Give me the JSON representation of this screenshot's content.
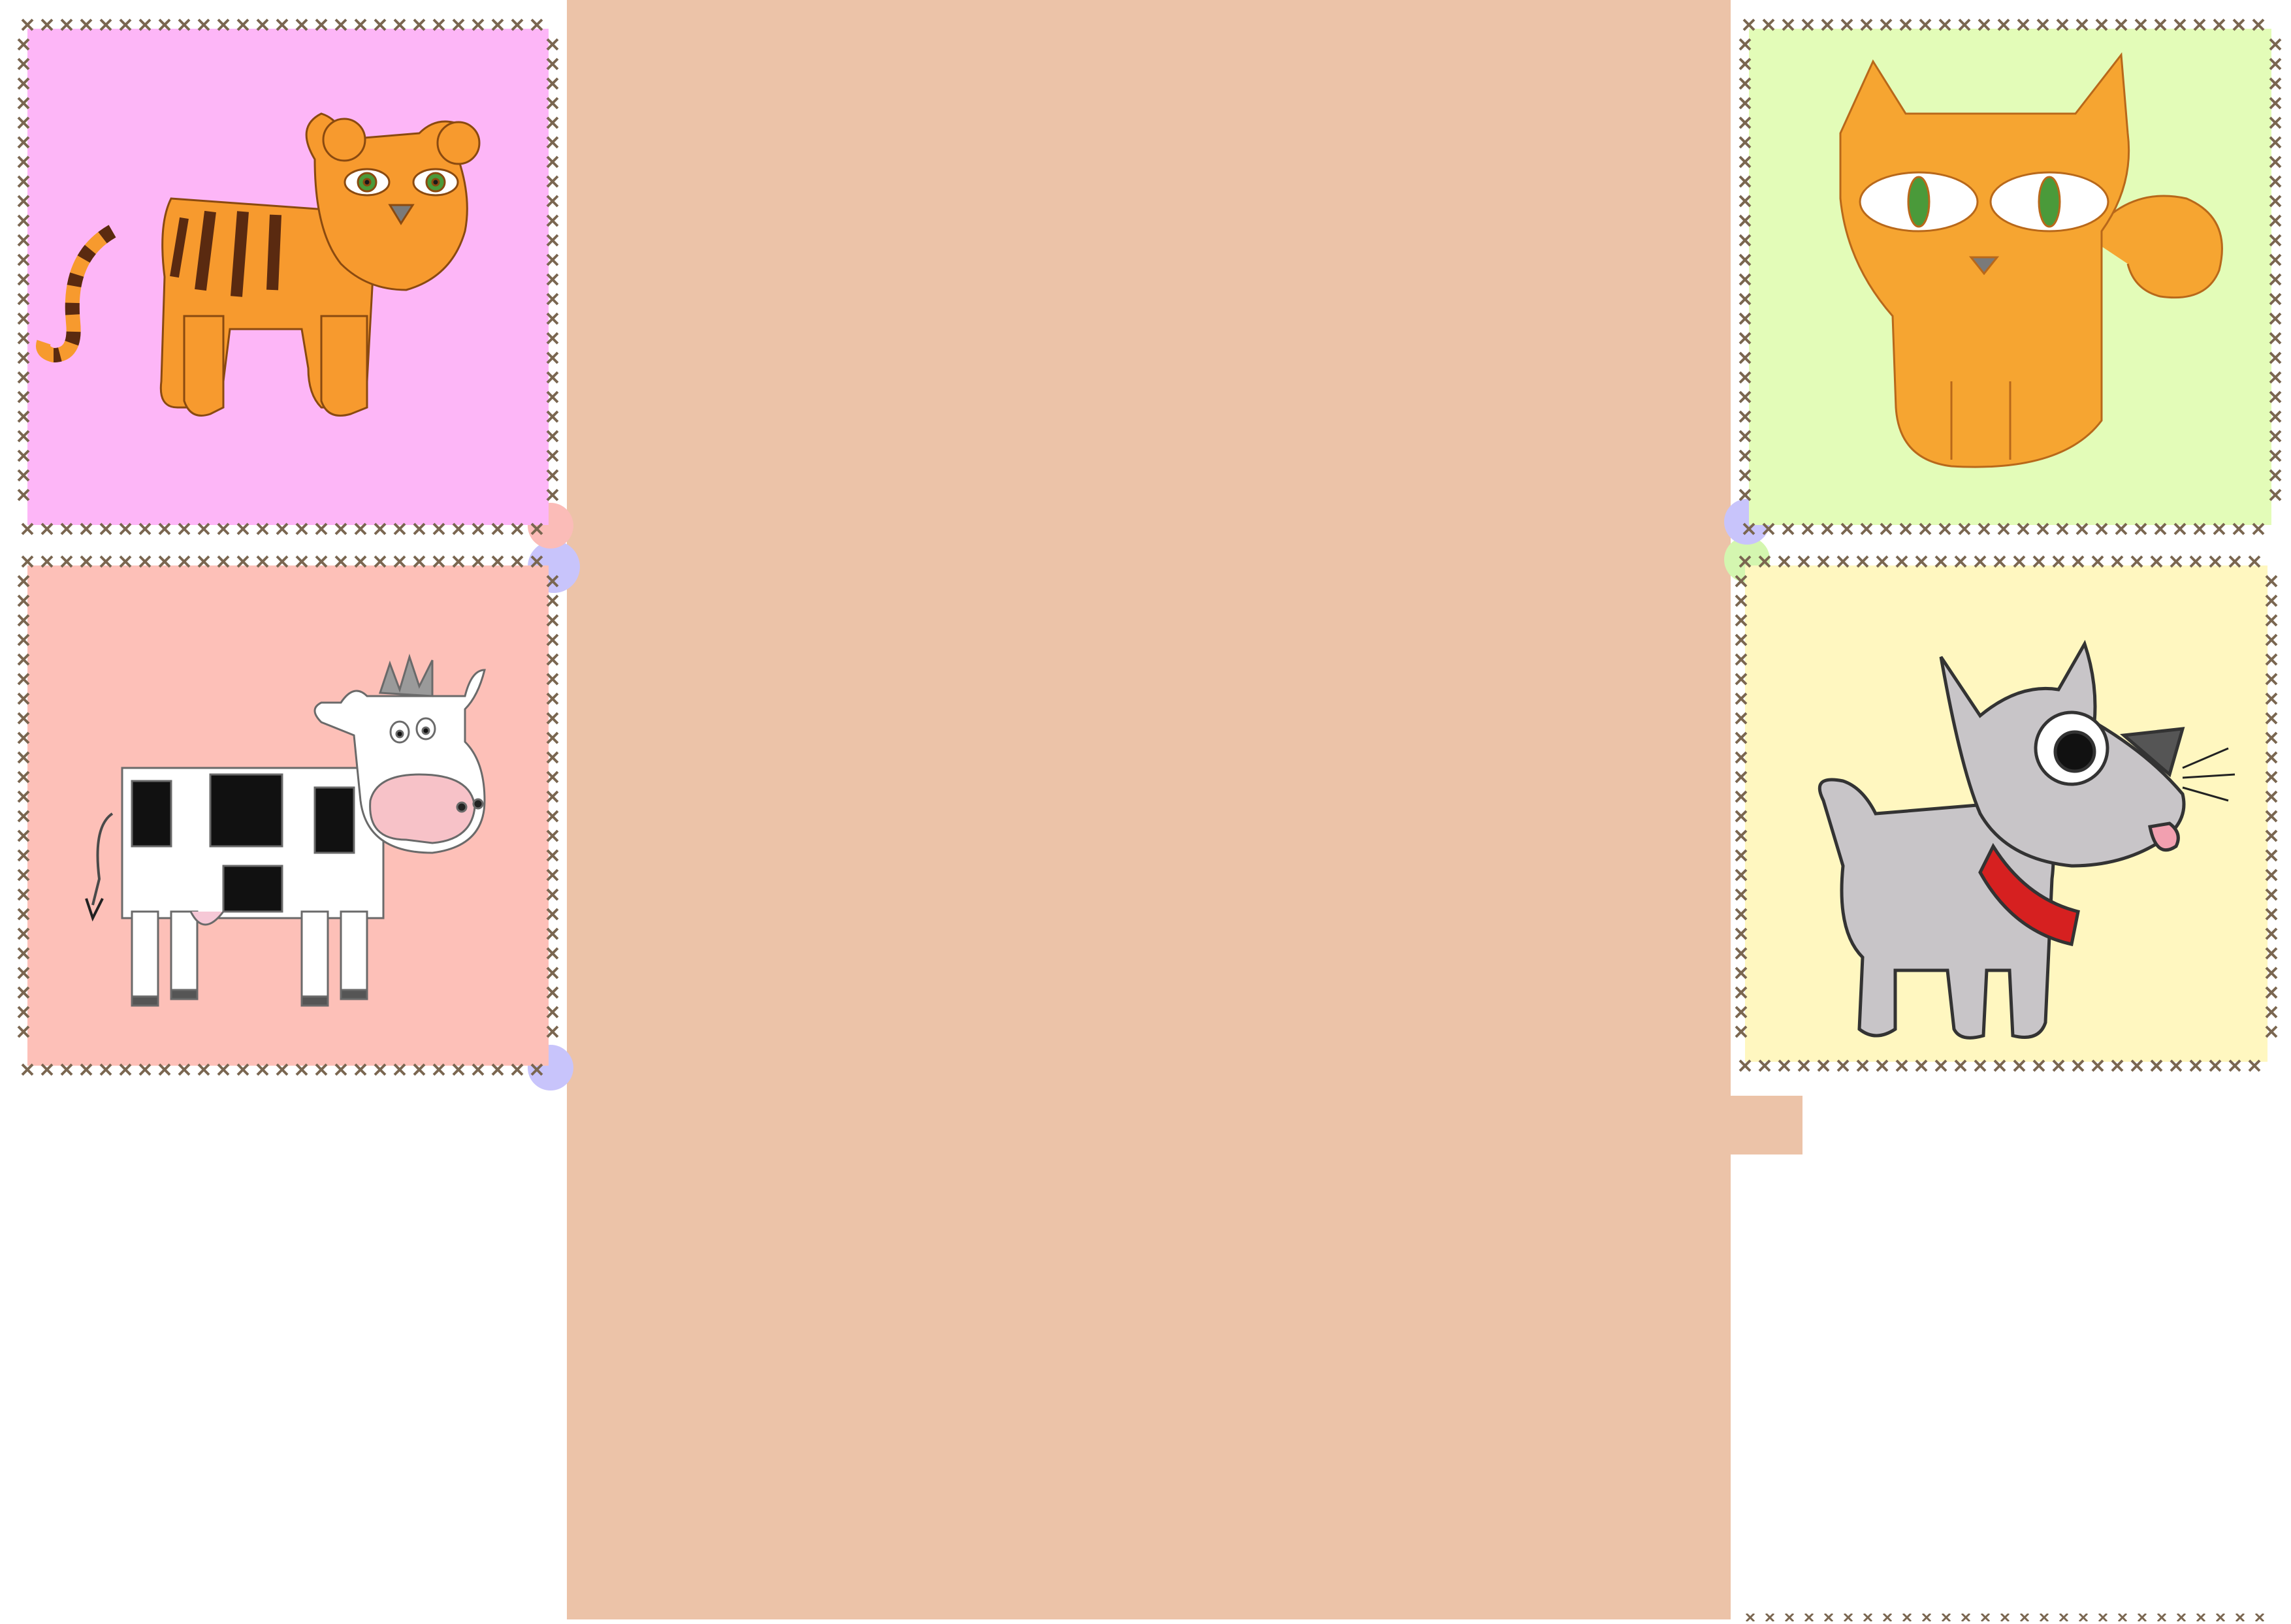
{
  "page": {
    "background_color": "#ffffff",
    "panel_color": "#ecc3a8",
    "stitch_color": "#7a6650"
  },
  "cards": [
    {
      "animal": "tiger",
      "icon": "tiger-icon",
      "background_color": "#fdb6f7"
    },
    {
      "animal": "cow",
      "icon": "cow-icon",
      "background_color": "#fdc0b8"
    },
    {
      "animal": "cat",
      "icon": "cat-icon",
      "background_color": "#e3fcb8"
    },
    {
      "animal": "dog",
      "icon": "dog-icon",
      "background_color": "#fff7c0"
    }
  ],
  "corner_accents": {
    "lavender": "#c8c4fb",
    "pink": "#fbbcb8",
    "green": "#d4f6b0"
  }
}
